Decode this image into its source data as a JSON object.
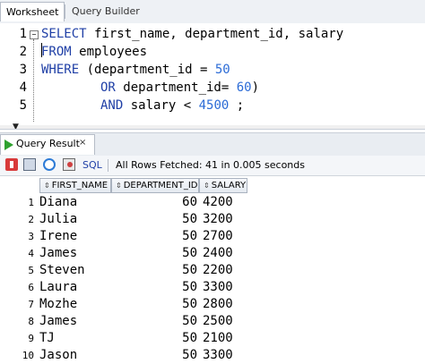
{
  "tabs": {
    "worksheet": "Worksheet",
    "query_builder": "Query Builder"
  },
  "editor": {
    "line_numbers": [
      "1",
      "2",
      "3",
      "4",
      "5"
    ],
    "line1": {
      "kw": "SELECT",
      "rest": " first_name, department_id, salary"
    },
    "line2": {
      "kw": "FROM",
      "rest": " employees"
    },
    "line3": {
      "kw": "WHERE",
      "rest": " (department_id = ",
      "num": "50"
    },
    "line4": {
      "kw": "OR",
      "rest": " department_id= ",
      "num": "60",
      "end": ")"
    },
    "line5": {
      "kw": "AND",
      "rest": " salary < ",
      "num": "4500",
      "end": " ;"
    },
    "fold_symbol": "−"
  },
  "results_tab": {
    "label": "Query Result",
    "close": "×"
  },
  "toolbar": {
    "sql_label": "SQL",
    "status": "All Rows Fetched: 41 in 0.005 seconds"
  },
  "grid": {
    "columns": [
      "FIRST_NAME",
      "DEPARTMENT_ID",
      "SALARY"
    ],
    "rows": [
      {
        "n": "1",
        "first_name": "Diana",
        "department_id": "60",
        "salary": "4200"
      },
      {
        "n": "2",
        "first_name": "Julia",
        "department_id": "50",
        "salary": "3200"
      },
      {
        "n": "3",
        "first_name": "Irene",
        "department_id": "50",
        "salary": "2700"
      },
      {
        "n": "4",
        "first_name": "James",
        "department_id": "50",
        "salary": "2400"
      },
      {
        "n": "5",
        "first_name": "Steven",
        "department_id": "50",
        "salary": "2200"
      },
      {
        "n": "6",
        "first_name": "Laura",
        "department_id": "50",
        "salary": "3300"
      },
      {
        "n": "7",
        "first_name": "Mozhe",
        "department_id": "50",
        "salary": "2800"
      },
      {
        "n": "8",
        "first_name": "James",
        "department_id": "50",
        "salary": "2500"
      },
      {
        "n": "9",
        "first_name": "TJ",
        "department_id": "50",
        "salary": "2100"
      },
      {
        "n": "10",
        "first_name": "Jason",
        "department_id": "50",
        "salary": "3300"
      }
    ]
  },
  "colors": {
    "keyword": "#1f3fa6",
    "number": "#2b6bd6",
    "run_icon": "#2fa12f"
  },
  "icons": [
    "fold-toggle-icon",
    "run-icon",
    "pin-icon",
    "print-icon",
    "refresh-icon",
    "export-icon",
    "sort-arrow-icon"
  ]
}
